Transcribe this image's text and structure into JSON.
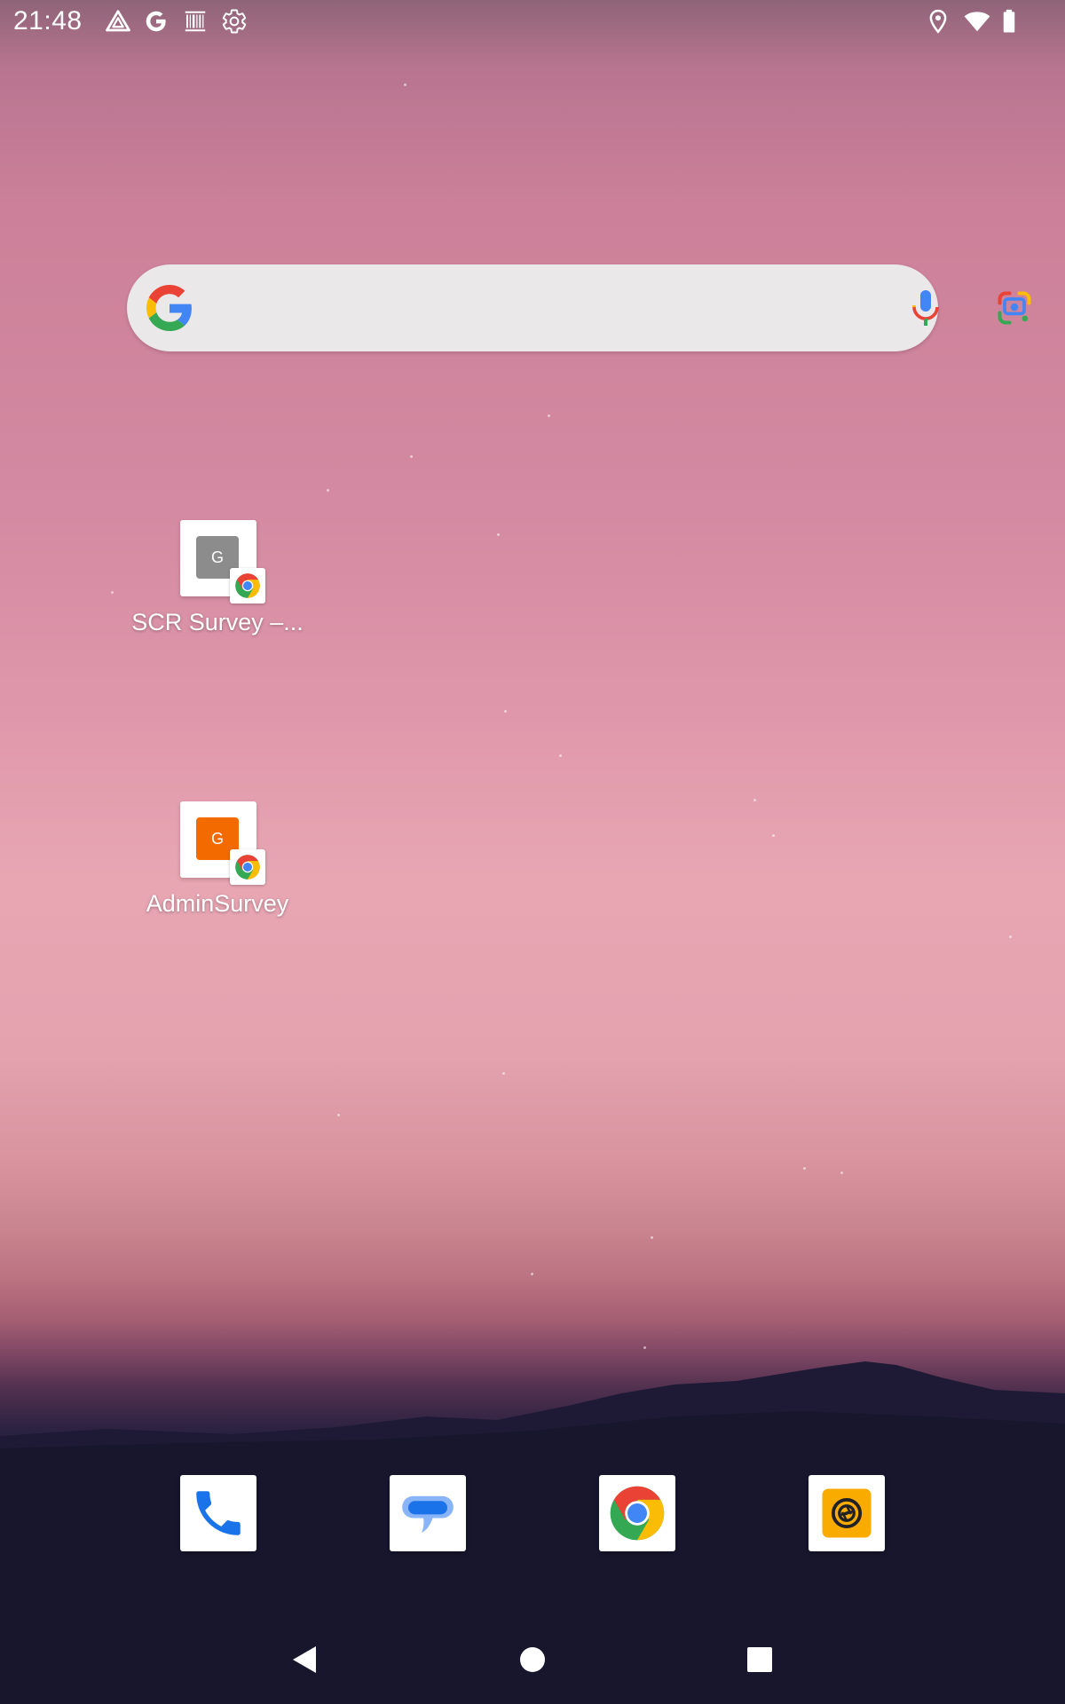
{
  "status_bar": {
    "time": "21:48",
    "left_icons": [
      "drive-icon",
      "google-icon",
      "barcode-icon",
      "settings-gear-icon"
    ],
    "right_icons": [
      "location-icon",
      "wifi-icon",
      "battery-icon"
    ]
  },
  "search_widget": {
    "logo": "google-g-icon",
    "mic": "mic-icon",
    "lens": "google-lens-icon"
  },
  "shortcuts": [
    {
      "label": "SCR Survey –...",
      "icon_letter": "G",
      "icon_color": "#8c8c8c",
      "badge": "chrome-icon"
    },
    {
      "label": "AdminSurvey",
      "icon_letter": "G",
      "icon_color": "#f26a00",
      "badge": "chrome-icon"
    }
  ],
  "dock": [
    {
      "app": "Phone",
      "icon": "phone-icon"
    },
    {
      "app": "Messages",
      "icon": "messages-icon"
    },
    {
      "app": "Chrome",
      "icon": "chrome-icon"
    },
    {
      "app": "Camera",
      "icon": "camera-icon"
    }
  ],
  "nav_bar": {
    "buttons": [
      "back-icon",
      "home-icon",
      "recents-icon"
    ]
  },
  "colors": {
    "google_blue": "#4285f4",
    "google_red": "#ea4335",
    "google_yellow": "#fbbc05",
    "google_green": "#34a853",
    "search_bg": "#ebe8ea",
    "camera_yellow": "#f9ab00"
  }
}
